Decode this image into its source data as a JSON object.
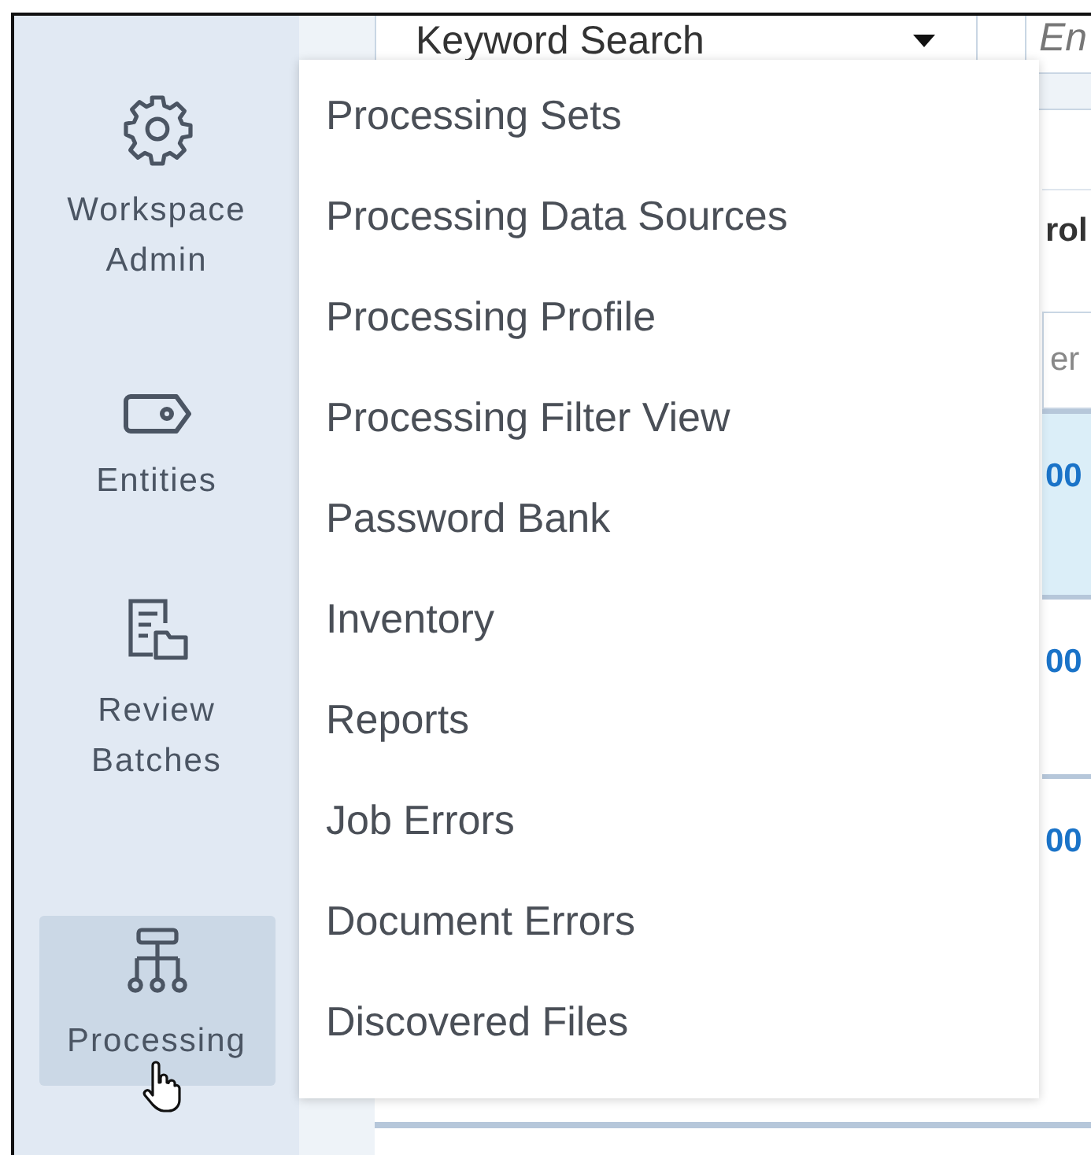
{
  "sidebar": {
    "items": [
      {
        "label": "Workspace\nAdmin",
        "selected": false
      },
      {
        "label": "Entities",
        "selected": false
      },
      {
        "label": "Review\nBatches",
        "selected": false
      },
      {
        "label": "Processing",
        "selected": true
      }
    ]
  },
  "toolbar": {
    "search_type": "Keyword Search",
    "search_field": {
      "placeholder": "En"
    }
  },
  "table": {
    "header": "rol",
    "filter_field": {
      "placeholder": "er"
    },
    "rows": [
      {
        "text": "00",
        "selected": true
      },
      {
        "text": "00",
        "selected": false
      },
      {
        "text": "00",
        "selected": false
      }
    ]
  },
  "menu": {
    "items": [
      "Processing Sets",
      "Processing Data Sources",
      "Processing Profile",
      "Processing Filter View",
      "Password Bank",
      "Inventory",
      "Reports",
      "Job Errors",
      "Document Errors",
      "Discovered Files"
    ]
  }
}
